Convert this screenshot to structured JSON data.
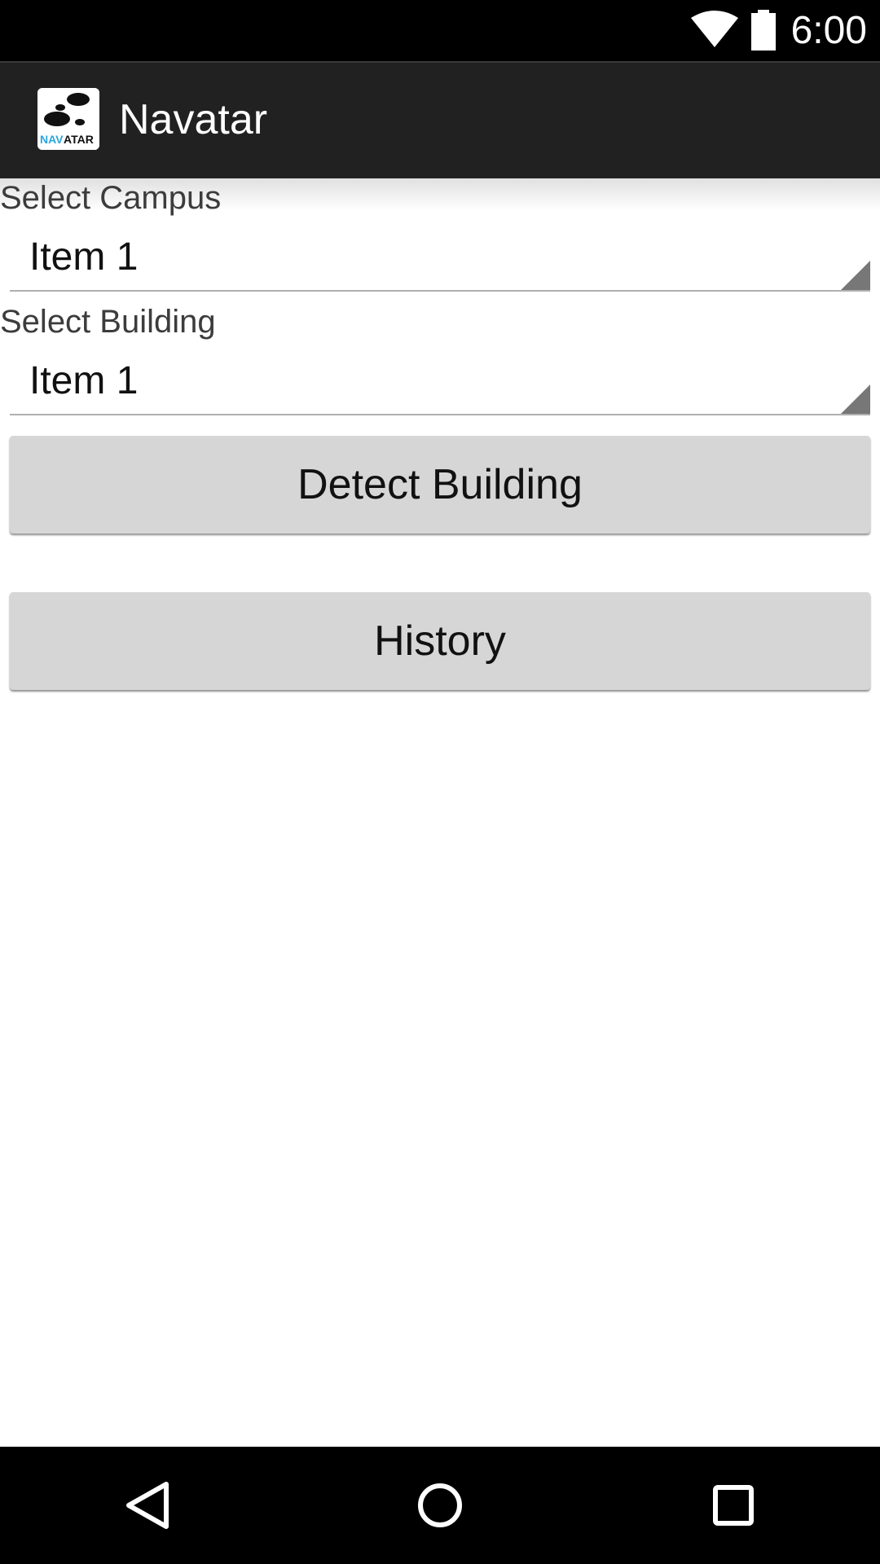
{
  "status_bar": {
    "time": "6:00",
    "icons": [
      "wifi-icon",
      "battery-icon"
    ]
  },
  "action_bar": {
    "title": "Navatar",
    "logo_text": "NAVATAR"
  },
  "form": {
    "campus_label": "Select Campus",
    "campus_value": "Item 1",
    "building_label": "Select Building",
    "building_value": "Item 1",
    "detect_button_label": "Detect Building",
    "history_button_label": "History"
  },
  "nav_bar": {
    "icons": [
      "back-icon",
      "home-icon",
      "recents-icon"
    ]
  },
  "colors": {
    "action_bar_bg": "#212121",
    "button_bg": "#d6d6d6",
    "logo_accent": "#29a8e0"
  }
}
